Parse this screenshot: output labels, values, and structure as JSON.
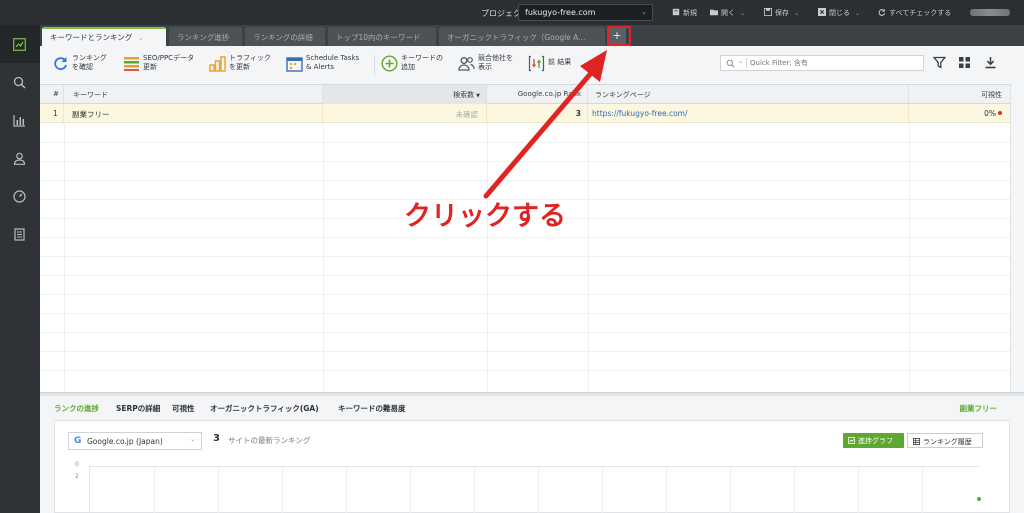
{
  "topbar": {
    "project_label": "プロジェクト:",
    "project_value": "fukugyo-free.com",
    "new": "新規",
    "open": "開く",
    "save": "保存",
    "close": "閉じる",
    "check_all": "すべてチェックする"
  },
  "tabs": [
    {
      "label": "キーワードとランキング"
    },
    {
      "label": "ランキング進捗"
    },
    {
      "label": "ランキングの詳細"
    },
    {
      "label": "トップ10内のキーワード"
    },
    {
      "label": "オーガニックトラフィック（Google A..."
    }
  ],
  "add_tab_label": "+",
  "toolbar": {
    "check_rankings": "ランキング\nを確認",
    "update_seo": "SEO/PPCデータ\n更新",
    "update_traffic": "トラフィック\nを更新",
    "schedule": "Schedule Tasks\n& Alerts",
    "add_keyword": "キーワードの\n追加",
    "show_competitors": "競合他社を\n表示",
    "prev_result": "前 結果",
    "quick_filter_placeholder": "Quick Filter: 含有"
  },
  "grid": {
    "headers": {
      "num": "#",
      "keyword": "キーワード",
      "search_volume": "検索数",
      "google_rank": "Google.co.jp Rank",
      "ranking_page": "ランキングページ",
      "visibility": "可視性"
    },
    "rows": [
      {
        "num": "1",
        "keyword": "副業フリー",
        "search_volume": "未確認",
        "google_rank": "3",
        "ranking_page": "https://fukugyo-free.com/",
        "visibility": "0%"
      }
    ]
  },
  "bottom": {
    "tabs": [
      {
        "label": "ランクの進捗"
      },
      {
        "label": "SERPの詳細"
      },
      {
        "label": "可視性"
      },
      {
        "label": "オーガニックトラフィック(GA)"
      },
      {
        "label": "キーワードの難易度"
      }
    ],
    "keyword_link": "副業フリー",
    "engine": "Google.co.jp (Japan)",
    "site_count": "3",
    "site_label": "サイトの最新ランキング",
    "progress_graph": "進捗グラフ",
    "ranking_history": "ランキング履歴",
    "y_ticks": [
      "0",
      "2"
    ]
  },
  "annotation": {
    "callout": "クリックする"
  },
  "colors": {
    "accent": "#5ea832",
    "annotation": "#e02424",
    "link": "#2b6cb0"
  }
}
